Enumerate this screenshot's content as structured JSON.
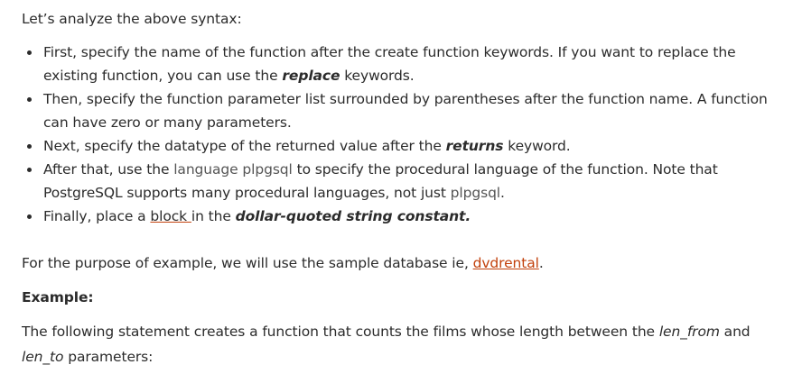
{
  "intro": "Let’s analyze the above syntax:",
  "points": {
    "p1": {
      "a": "First, specify the name of the function after the create function keywords. If you want to replace the existing function, you can use the ",
      "b": "replace",
      "c": " keywords."
    },
    "p2": {
      "a": "Then, specify the function parameter list surrounded by parentheses after the function name. A function can have zero or many parameters."
    },
    "p3": {
      "a": "Next, specify the datatype of the returned value after the ",
      "b": "returns",
      "c": " keyword."
    },
    "p4": {
      "a": "After that, use the ",
      "b": "language plpgsql",
      "c": " to specify the procedural language of the function. Note that PostgreSQL supports many procedural languages, not just ",
      "d": "plpgsql",
      "e": "."
    },
    "p5": {
      "a": "Finally, place a ",
      "b": "block ",
      "c": "in the ",
      "d": "dollar-quoted",
      "e": " string constant."
    }
  },
  "purpose": {
    "a": "For the purpose of example, we will use the sample database ie, ",
    "link": "dvdrental",
    "b": "."
  },
  "example_heading": "Example:",
  "statement": {
    "a": "The following statement creates a function that counts the films whose length between the ",
    "b": "len_from",
    "c": " and ",
    "d": "len_to",
    "e": " parameters:"
  },
  "colors": {
    "link": "#c2410c",
    "text": "#2b2b2b"
  }
}
